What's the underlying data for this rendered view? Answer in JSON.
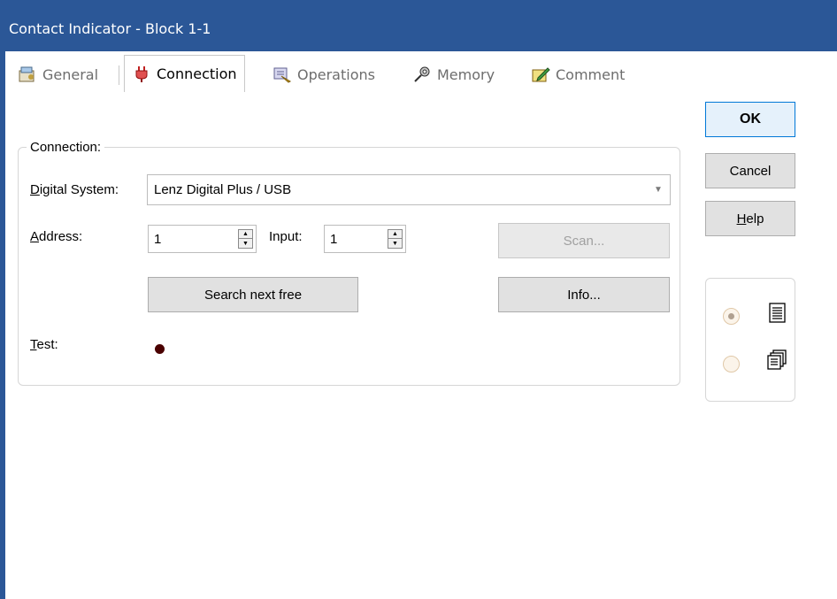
{
  "window": {
    "title": "Contact Indicator - Block 1-1"
  },
  "tabs": [
    {
      "label": "General",
      "icon": "general-icon"
    },
    {
      "label": "Connection",
      "icon": "plug-icon",
      "active": true
    },
    {
      "label": "Operations",
      "icon": "operations-icon"
    },
    {
      "label": "Memory",
      "icon": "memory-icon"
    },
    {
      "label": "Comment",
      "icon": "comment-icon"
    }
  ],
  "connection": {
    "group_label": "Connection:",
    "digital_system_label": "Digital System:",
    "digital_system_value": "Lenz Digital Plus / USB",
    "address_label": "Address:",
    "address_value": "1",
    "input_label": "Input:",
    "input_value": "1",
    "scan_label": "Scan...",
    "search_next_free_label": "Search next free",
    "info_label": "Info...",
    "test_label": "Test:",
    "led_color": "#4a0000"
  },
  "buttons": {
    "ok": "OK",
    "cancel": "Cancel",
    "help": "Help"
  },
  "view_options": {
    "selected": "list-view"
  },
  "colors": {
    "titlebar": "#2b5797",
    "default_button_border": "#0078d7"
  }
}
